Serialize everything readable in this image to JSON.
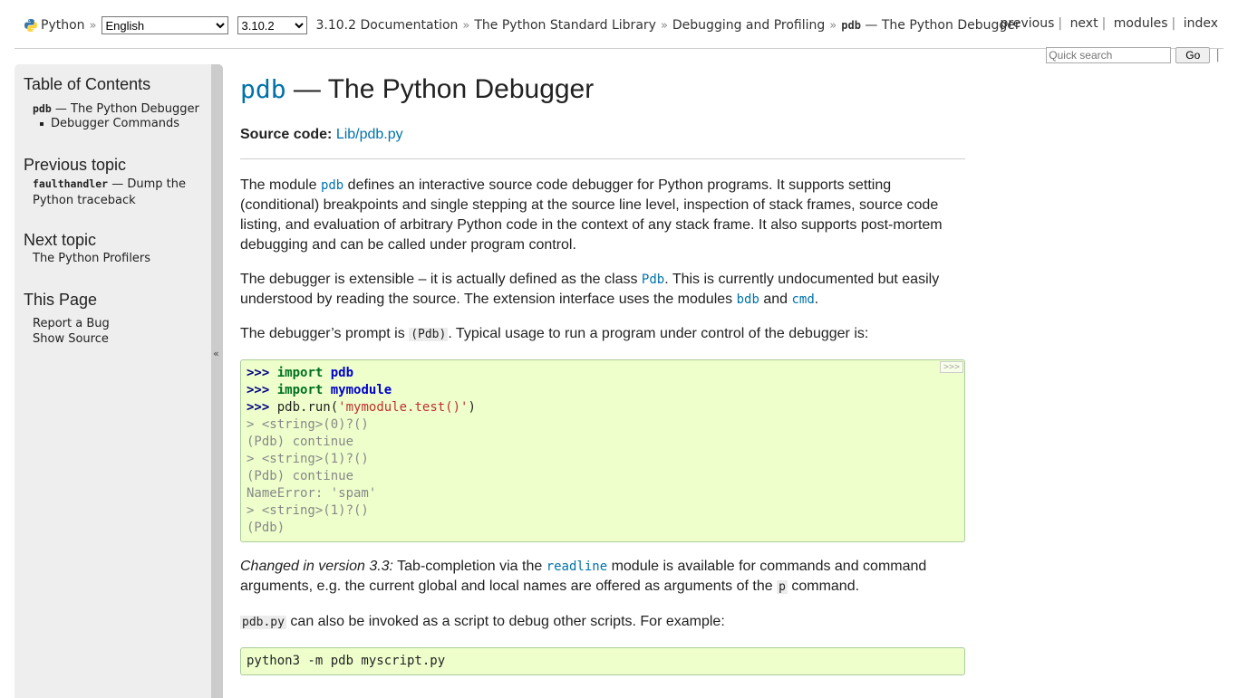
{
  "topbar": {
    "python_label": "Python",
    "language_select": "English",
    "version_select": "3.10.2",
    "breadcrumbs": [
      "3.10.2 Documentation",
      "The Python Standard Library",
      "Debugging and Profiling"
    ],
    "current_code": "pdb",
    "current_rest": " — The Python Debugger",
    "nav": [
      "previous",
      "next",
      "modules",
      "index"
    ]
  },
  "search": {
    "placeholder": "Quick search",
    "go_label": "Go"
  },
  "sidebar": {
    "toc_heading": "Table of Contents",
    "toc_code": "pdb",
    "toc_rest": " — The Python Debugger",
    "toc_sub": "Debugger Commands",
    "prev_heading": "Previous topic",
    "prev_code": "faulthandler",
    "prev_rest": " — Dump the Python traceback",
    "next_heading": "Next topic",
    "next_link": "The Python Profilers",
    "page_heading": "This Page",
    "report_bug": "Report a Bug",
    "show_source": "Show Source",
    "collapse_glyph": "«"
  },
  "main": {
    "title_code": "pdb",
    "title_rest": " — The Python Debugger",
    "source_label": "Source code:",
    "source_link": "Lib/pdb.py",
    "p1a": "The module ",
    "p1code": "pdb",
    "p1b": " defines an interactive source code debugger for Python programs. It supports setting (conditional) breakpoints and single stepping at the source line level, inspection of stack frames, source code listing, and evaluation of arbitrary Python code in the context of any stack frame. It also supports post-mortem debugging and can be called under program control.",
    "p2a": "The debugger is extensible – it is actually defined as the class ",
    "p2code1": "Pdb",
    "p2b": ". This is currently undocumented but easily understood by reading the source. The extension interface uses the modules ",
    "p2code2": "bdb",
    "p2c": " and ",
    "p2code3": "cmd",
    "p2d": ".",
    "p3a": "The debugger’s prompt is ",
    "p3code": "(Pdb)",
    "p3b": ". Typical usage to run a program under control of the debugger is:",
    "code1": {
      "prompt": ">>>",
      "kw_import": "import",
      "mod1": "pdb",
      "mod2": "mymodule",
      "call_pre": "pdb.run(",
      "call_str": "'mymodule.test()'",
      "call_post": ")",
      "out1": "> <string>(0)?()",
      "out2": "(Pdb) continue",
      "out3": "> <string>(1)?()",
      "out4": "(Pdb) continue",
      "out5": "NameError: 'spam'",
      "out6": "> <string>(1)?()",
      "out7": "(Pdb)",
      "copy_label": ">>>"
    },
    "p4em": "Changed in version 3.3:",
    "p4a": " Tab-completion via the ",
    "p4code1": "readline",
    "p4b": " module is available for commands and command arguments, e.g. the current global and local names are offered as arguments of the ",
    "p4code2": "p",
    "p4c": " command.",
    "p5code": "pdb.py",
    "p5a": " can also be invoked as a script to debug other scripts. For example:",
    "code2": "python3 -m pdb myscript.py"
  }
}
